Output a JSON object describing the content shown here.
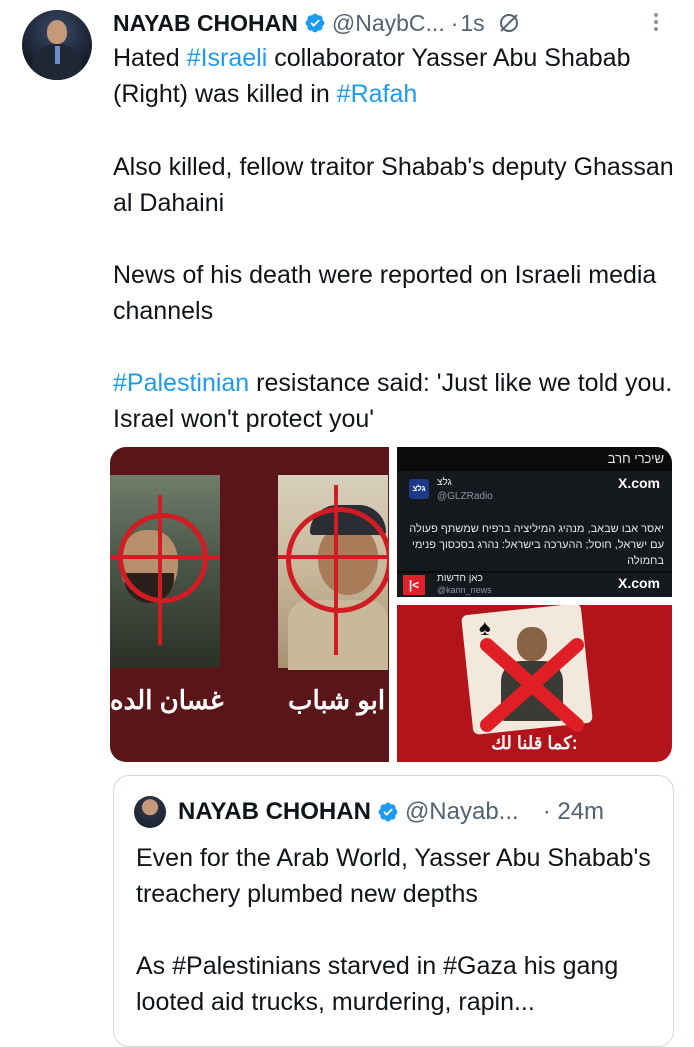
{
  "tweet": {
    "author_name": "NAYAB CHOHAN",
    "handle": "@NaybC...",
    "separator": "·",
    "time": "1s",
    "avatar_caption": "NAYAB CHOHAN",
    "paragraphs": [
      [
        {
          "text": "Hated ",
          "tag": false
        },
        {
          "text": "#Israeli",
          "tag": true
        },
        {
          "text": " collaborator Yasser Abu Shabab (Right) was killed in ",
          "tag": false
        },
        {
          "text": "#Rafah",
          "tag": true
        }
      ],
      [
        {
          "text": "Also killed, fellow traitor Shabab's deputy Ghassan al Dahaini",
          "tag": false
        }
      ],
      [
        {
          "text": "News of his death were reported on Israeli media channels",
          "tag": false
        }
      ],
      [
        {
          "text": "#Palestinian",
          "tag": true
        },
        {
          "text": " resistance said: 'Just like we told you. Israel won't protect you'",
          "tag": false
        }
      ]
    ]
  },
  "media": {
    "left": {
      "label_1": "غسان الده",
      "label_2": "ر ابو شباب"
    },
    "right_top": {
      "header_hebrew": "שיכרי חרב",
      "source_1_name": "גלצ",
      "source_1_handle": "@GLZRadio",
      "logo_text": "גלצ",
      "xcom": "X.com",
      "body_hebrew": "יאסר אבו שבאב, מנהיג המיליציה ברפיח שמשתף פעולה עם ישראל, חוסל; ההערכה בישראל: נהרג בסכסוך פנימי בחמולה",
      "source_2_name": "כאן חדשות",
      "source_2_handle": "@kann_news",
      "kan_logo": "|<"
    },
    "right_bottom": {
      "caption": "كما قلنا لك:"
    }
  },
  "quote": {
    "author_name": "NAYAB CHOHAN",
    "handle": "@Nayab...",
    "time": "· 24m",
    "paragraphs": [
      "Even for the Arab World, Yasser Abu Shabab's treachery plumbed new depths",
      "As #Palestinians starved in #Gaza his gang looted aid trucks, murdering, rapin..."
    ]
  },
  "colors": {
    "link": "#1d9bf0",
    "verified": "#1d9bf0",
    "secondary_text": "#536471",
    "media_red": "#b3141c"
  },
  "icons": [
    "verified-badge-icon",
    "grok-icon",
    "more-options-icon"
  ]
}
